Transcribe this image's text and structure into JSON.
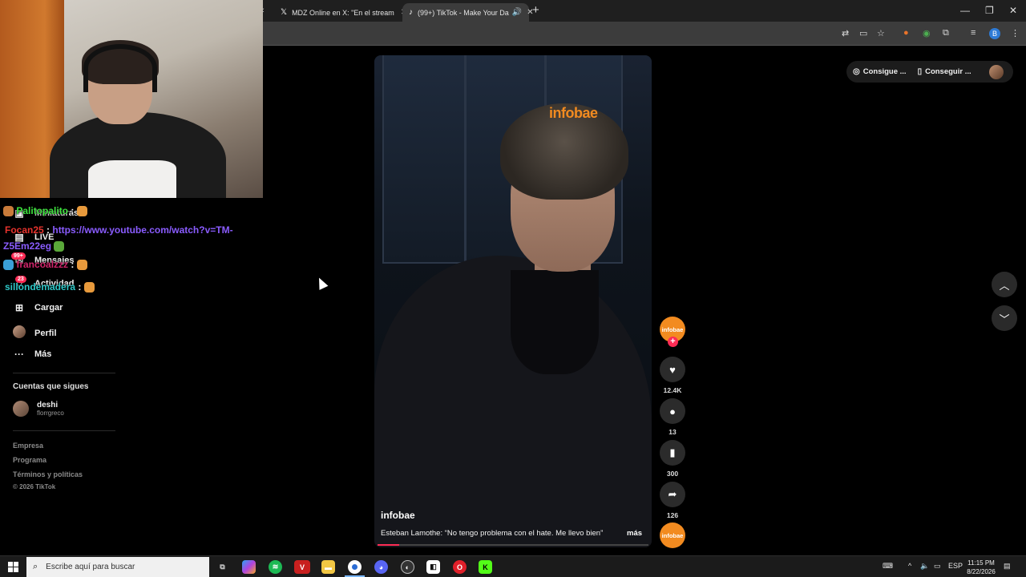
{
  "browser": {
    "tabs": [
      {
        "title": "MDZ Online en X: \"En el stream",
        "icon": "x-logo"
      },
      {
        "title": "(99+) TikTok - Make Your Da",
        "icon": "tiktok-logo",
        "active": true
      }
    ],
    "new_tab": "+",
    "window_controls": {
      "minimize": "—",
      "restore": "❐",
      "close": "✕"
    },
    "profile_initial": "B"
  },
  "sidebar": {
    "nav": [
      {
        "label": "Miniaturas",
        "icon": "monitor-icon"
      },
      {
        "label": "LIVE",
        "icon": "live-icon"
      },
      {
        "label": "Mensajes",
        "icon": "message-icon",
        "badge": "99+"
      },
      {
        "label": "Actividad",
        "icon": "bell-icon",
        "badge": "23"
      },
      {
        "label": "Cargar",
        "icon": "plus-square-icon"
      },
      {
        "label": "Perfil",
        "icon": "profile-avatar"
      },
      {
        "label": "Más",
        "icon": "more-icon"
      }
    ],
    "following_title": "Cuentas que sigues",
    "following": [
      {
        "name": "deshi",
        "handle": "florrgreco"
      }
    ],
    "footer": [
      "Empresa",
      "Programa",
      "Términos y políticas"
    ],
    "copyright": "© 2026 TikTok"
  },
  "chat": [
    {
      "user": "Palitopalito",
      "sep": " :",
      "message": ""
    },
    {
      "user": "Focan25",
      "sep": " : ",
      "message": "https://www.youtube.com/watch?v=TM-",
      "message2": "Z5Em22eg"
    },
    {
      "user": "francoalzzz",
      "sep": " :",
      "message": ""
    },
    {
      "user": "sillondemadera",
      "sep": " :",
      "message": ""
    }
  ],
  "video": {
    "watermark": "infobae",
    "author": "infobae",
    "caption": "Esteban Lamothe: “No tengo problema con el hate. Me llevo bien”",
    "more": "más",
    "progress": 0.08
  },
  "actions": {
    "avatar_label": "infobae",
    "follow": "+",
    "likes": "12.4K",
    "comments": "13",
    "saves": "300",
    "shares": "126",
    "sound_label": "infobae"
  },
  "top_right": {
    "pill1": "Consigue ...",
    "pill2": "Conseguir ..."
  },
  "taskbar": {
    "search_placeholder": "Escribe aquí para buscar",
    "language": "ESP",
    "time": "11:15 PM",
    "date": "8/22/2026"
  }
}
